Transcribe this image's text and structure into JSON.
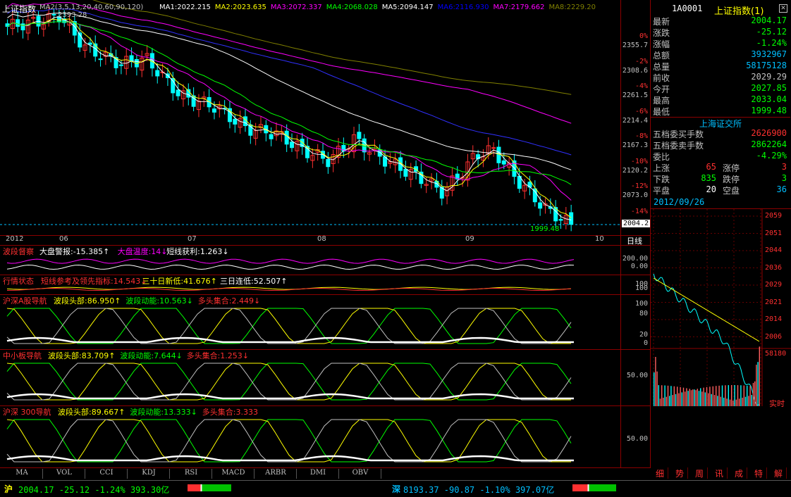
{
  "main_chart": {
    "title": "上证指数",
    "ma_params": "MA2(3,5,13,20,40,60,90,120)",
    "ma_values": [
      {
        "label": "MA1:2022.215",
        "color": "#ffffff"
      },
      {
        "label": "MA2:2023.635",
        "color": "#ffff00"
      },
      {
        "label": "MA3:2072.337",
        "color": "#ff00ff"
      },
      {
        "label": "MA4:2068.028",
        "color": "#00ff00"
      },
      {
        "label": "MA5:2094.147",
        "color": "#ffffff"
      },
      {
        "label": "MA6:2116.930",
        "color": "#0000ff"
      },
      {
        "label": "MA7:2179.662",
        "color": "#ff00ff"
      },
      {
        "label": "MA8:2229.20",
        "color": "#808000"
      }
    ],
    "high_label": "2393.28",
    "low_label": "1999.48",
    "last_price": "2004.2",
    "price_ticks": [
      "2355.7",
      "2308.6",
      "2261.5",
      "2214.4",
      "2167.3",
      "2120.2",
      "2073.0"
    ],
    "pct_ticks": [
      "0%",
      "-2%",
      "-4%",
      "-6%",
      "-8%",
      "-10%",
      "-12%",
      "-14%"
    ],
    "time_labels": [
      "2012",
      "06",
      "07",
      "08",
      "09",
      "10"
    ],
    "period": "日线",
    "colors": {
      "up": "#ff3030",
      "down": "#00ffff"
    }
  },
  "indicators": [
    {
      "name": "波段督察",
      "items": [
        {
          "t": "大盘警报:-15.385↑",
          "c": "#ffffff"
        },
        {
          "t": "大盘温度:14↓",
          "c": "#ff00ff"
        },
        {
          "t": "短线获利:1.263↓",
          "c": "#ffffff"
        }
      ],
      "ticks": [
        "200.00",
        "0.00"
      ]
    },
    {
      "name": "行情状态",
      "items": [
        {
          "t": "短线参考及领先指标:14.543↓",
          "c": "#ff3030"
        },
        {
          "t": "三十日新低:41.676↑",
          "c": "#ffff00"
        },
        {
          "t": "三日连低:52.507↑",
          "c": "#ffffff"
        }
      ],
      "ticks": [
        "100",
        "100"
      ]
    },
    {
      "name": "沪深A股导航",
      "items": [
        {
          "t": "波段头部:86.950↑",
          "c": "#ffff00"
        },
        {
          "t": "波段动能:10.563↓",
          "c": "#00ff00"
        },
        {
          "t": "多头集合:2.449↓",
          "c": "#ff3030"
        }
      ],
      "ticks": [
        "100",
        "80",
        "20",
        "0"
      ]
    },
    {
      "name": "中小板导航",
      "items": [
        {
          "t": "波段头部:83.709↑",
          "c": "#ffff00"
        },
        {
          "t": "波段动能:7.644↓",
          "c": "#00ff00"
        },
        {
          "t": "多头集合:1.253↓",
          "c": "#ff3030"
        }
      ],
      "ticks": [
        "50.00"
      ]
    },
    {
      "name": "沪深 300导航",
      "items": [
        {
          "t": "波段头部:89.667↑",
          "c": "#ffff00"
        },
        {
          "t": "波段动能:13.333↓",
          "c": "#00ff00"
        },
        {
          "t": "多头集合:3.333",
          "c": "#ff3030"
        }
      ],
      "ticks": [
        "50.00"
      ]
    }
  ],
  "bottom_tabs": [
    "MA",
    "VOL",
    "CCI",
    "KDJ",
    "RSI",
    "MACD",
    "ARBR",
    "DMI",
    "OBV"
  ],
  "quote": {
    "code": "1A0001",
    "name": "上证指数(1)",
    "rows": [
      {
        "k": "最新",
        "v": "2004.17",
        "c": "#00ff00"
      },
      {
        "k": "涨跌",
        "v": "-25.12",
        "c": "#00ff00"
      },
      {
        "k": "涨幅",
        "v": "-1.24%",
        "c": "#00ff00"
      },
      {
        "k": "总额",
        "v": "3932967",
        "c": "#00bfff"
      },
      {
        "k": "总量",
        "v": "58175128",
        "c": "#00bfff"
      },
      {
        "k": "前收",
        "v": "2029.29",
        "c": "#c0c0c0"
      },
      {
        "k": "今开",
        "v": "2027.85",
        "c": "#00ff00"
      },
      {
        "k": "最高",
        "v": "2033.04",
        "c": "#00ff00"
      },
      {
        "k": "最低",
        "v": "1999.48",
        "c": "#00ff00"
      }
    ],
    "exchange": "上海证交所",
    "depth": [
      {
        "k": "五档委买手数",
        "v": "2626900",
        "c": "#ff3030"
      },
      {
        "k": "五档委卖手数",
        "v": "2862264",
        "c": "#00ff00"
      },
      {
        "k": "委比",
        "v": "-4.29%",
        "c": "#00ff00"
      }
    ],
    "breadth": [
      {
        "k1": "上涨",
        "v1": "65",
        "k2": "涨停",
        "v2": "3"
      },
      {
        "k1": "下跌",
        "v1": "835",
        "k2": "跌停",
        "v2": "3"
      },
      {
        "k1": "平盘",
        "v1": "20",
        "k2": "空盘",
        "v2": "36"
      }
    ],
    "date": "2012/09/26"
  },
  "intraday": {
    "ticks": [
      "2059",
      "2051",
      "2044",
      "2036",
      "2029",
      "2021",
      "2014",
      "2006"
    ],
    "vol_max": "58180",
    "realtime_label": "实时"
  },
  "right_tabs": [
    "细",
    "势",
    "周",
    "讯",
    "成",
    "特",
    "解"
  ],
  "status": {
    "sh_label": "沪",
    "sh_text": "2004.17  -25.12  -1.24%  393.30亿",
    "sz_label": "深",
    "sz_text": "8193.37  -90.87  -1.10%  397.07亿"
  }
}
